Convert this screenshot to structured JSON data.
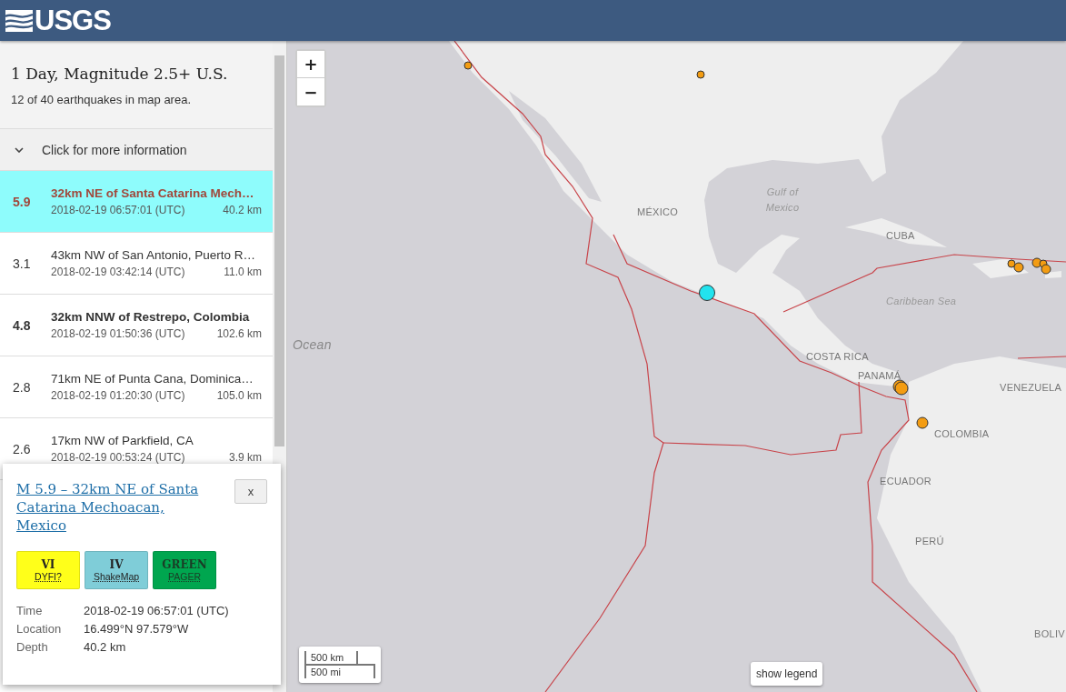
{
  "header": {
    "logo_text": "USGS"
  },
  "sidebar": {
    "title": "1 Day, Magnitude 2.5+ U.S.",
    "subtitle": "12 of 40 earthquakes in map area.",
    "info_toggle": {
      "label": "Click for more information",
      "expanded": false
    }
  },
  "events": [
    {
      "magnitude": "5.9",
      "place": "32km NE of Santa Catarina Mech…",
      "time": "2018-02-19 06:57:01 (UTC)",
      "depth": "40.2 km",
      "selected": true,
      "significant": true
    },
    {
      "magnitude": "3.1",
      "place": "43km NW of San Antonio, Puerto R…",
      "time": "2018-02-19 03:42:14 (UTC)",
      "depth": "11.0 km",
      "selected": false,
      "significant": false
    },
    {
      "magnitude": "4.8",
      "place": "32km NNW of Restrepo, Colombia",
      "time": "2018-02-19 01:50:36 (UTC)",
      "depth": "102.6 km",
      "selected": false,
      "significant": true
    },
    {
      "magnitude": "2.8",
      "place": "71km NE of Punta Cana, Dominica…",
      "time": "2018-02-19 01:20:30 (UTC)",
      "depth": "105.0 km",
      "selected": false,
      "significant": false
    },
    {
      "magnitude": "2.6",
      "place": "17km NW of Parkfield, CA",
      "time": "2018-02-19 00:53:24 (UTC)",
      "depth": "3.9 km",
      "selected": false,
      "significant": false
    }
  ],
  "popup": {
    "title": "M 5.9 – 32km NE of Santa Catarina Mechoacan, Mexico",
    "close": "x",
    "impact_badges": [
      {
        "value": "VI",
        "label": "DYFI?",
        "color": "#ffff1a"
      },
      {
        "value": "IV",
        "label": "ShakeMap",
        "color": "#7fcdd8"
      },
      {
        "value": "GREEN",
        "label": "PAGER",
        "color": "#00a64f"
      }
    ],
    "details": [
      {
        "label": "Time",
        "value": "2018-02-19 06:57:01 (UTC)"
      },
      {
        "label": "Location",
        "value": "16.499°N 97.579°W"
      },
      {
        "label": "Depth",
        "value": "40.2 km"
      }
    ]
  },
  "map": {
    "zoom_in": "+",
    "zoom_out": "−",
    "labels": [
      {
        "text": "MÉXICO",
        "kind": "country"
      },
      {
        "text": "Gulf of Mexico",
        "kind": "water"
      },
      {
        "text": "CUBA",
        "kind": "country"
      },
      {
        "text": "Caribbean Sea",
        "kind": "water"
      },
      {
        "text": "COSTA RICA",
        "kind": "country"
      },
      {
        "text": "PANAMÁ",
        "kind": "country"
      },
      {
        "text": "VENEZUELA",
        "kind": "country"
      },
      {
        "text": "COLOMBIA",
        "kind": "country"
      },
      {
        "text": "ECUADOR",
        "kind": "country"
      },
      {
        "text": "PERÚ",
        "kind": "country"
      },
      {
        "text": "BOLIV",
        "kind": "country"
      },
      {
        "text": "Ocean",
        "kind": "ocean"
      }
    ],
    "scale": {
      "metric": "500 km",
      "imperial": "500 mi"
    },
    "legend_button": "show legend"
  }
}
